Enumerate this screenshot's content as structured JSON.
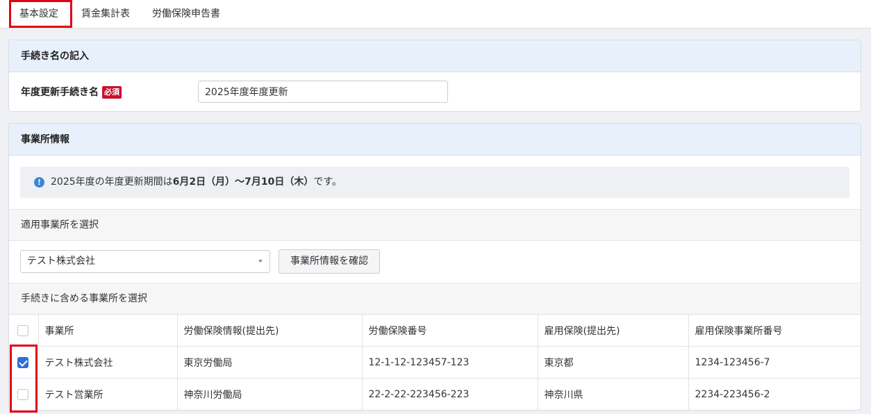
{
  "tabs": [
    {
      "label": "基本設定",
      "active": true
    },
    {
      "label": "賃金集計表",
      "active": false
    },
    {
      "label": "労働保険申告書",
      "active": false
    }
  ],
  "procedure_card": {
    "header": "手続き名の記入",
    "field_label": "年度更新手続き名",
    "required_badge": "必須",
    "input_value": "2025年度年度更新"
  },
  "office_card": {
    "header": "事業所情報",
    "notice_prefix": "2025年度の年度更新期間は",
    "notice_bold": "6月2日（月）〜7月10日（木）",
    "notice_suffix": "です。",
    "select_section_label": "適用事業所を選択",
    "selected_office": "テスト株式会社",
    "confirm_button": "事業所情報を確認",
    "include_section_label": "手続きに含める事業所を選択",
    "table": {
      "columns": [
        "事業所",
        "労働保険情報(提出先)",
        "労働保険番号",
        "雇用保険(提出先)",
        "雇用保険事業所番号"
      ],
      "rows": [
        {
          "checked": true,
          "cells": [
            "テスト株式会社",
            "東京労働局",
            "12-1-12-123457-123",
            "東京都",
            "1234-123456-7"
          ]
        },
        {
          "checked": false,
          "cells": [
            "テスト営業所",
            "神奈川労働局",
            "22-2-22-223456-223",
            "神奈川県",
            "2234-223456-2"
          ]
        }
      ]
    }
  },
  "colors": {
    "highlight": "#e30012",
    "header_bg": "#e8f1fb",
    "check_blue": "#2f6fd6",
    "badge_red": "#c8102e"
  }
}
